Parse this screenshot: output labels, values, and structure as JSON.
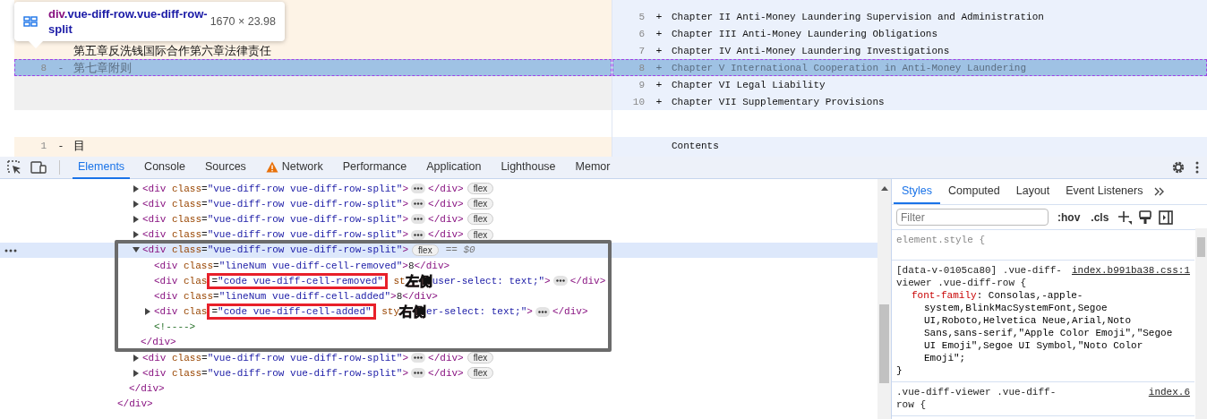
{
  "diff": {
    "left_rows": [
      {
        "kind": "cut"
      },
      {
        "kind": "hidden"
      },
      {
        "kind": "hidden"
      },
      {
        "kind": "line",
        "text": "第五章反洗钱国际合作第六章法律责任",
        "selected": false
      },
      {
        "kind": "line",
        "line": "8",
        "sign": "-",
        "text": "第七章附则",
        "selected": true
      },
      {
        "kind": "empty"
      },
      {
        "kind": "empty"
      }
    ],
    "right_rows": [
      {
        "kind": "cut"
      },
      {
        "kind": "line",
        "line": "5",
        "sign": "+",
        "text": "Chapter II Anti-Money Laundering Supervision and Administration",
        "selected": false
      },
      {
        "kind": "line",
        "line": "6",
        "sign": "+",
        "text": "Chapter III Anti-Money Laundering Obligations",
        "selected": false
      },
      {
        "kind": "line",
        "line": "7",
        "sign": "+",
        "text": "Chapter IV Anti-Money Laundering Investigations",
        "selected": false
      },
      {
        "kind": "line",
        "line": "8",
        "sign": "+",
        "text": "Chapter V International Cooperation in Anti-Money Laundering",
        "selected": true
      },
      {
        "kind": "line",
        "line": "9",
        "sign": "+",
        "text": "Chapter VI Legal Liability",
        "selected": false
      },
      {
        "kind": "line",
        "line": "10",
        "sign": "+",
        "text": "Chapter VII Supplementary Provisions",
        "selected": false
      }
    ],
    "next_left": {
      "line": "1",
      "sign": "-",
      "text": "目"
    },
    "next_right": {
      "text": "Contents"
    },
    "tooltip": {
      "tag": "div",
      "classes": ".vue-diff-row.vue-diff-row-split",
      "size": "1670 × 23.98"
    }
  },
  "devtools": {
    "tabs": [
      {
        "label": "Elements",
        "selected": true,
        "warning": false
      },
      {
        "label": "Console",
        "selected": false,
        "warning": false
      },
      {
        "label": "Sources",
        "selected": false,
        "warning": false
      },
      {
        "label": "Network",
        "selected": false,
        "warning": true
      },
      {
        "label": "Performance",
        "selected": false,
        "warning": false
      },
      {
        "label": "Application",
        "selected": false,
        "warning": false
      },
      {
        "label": "Lighthouse",
        "selected": false,
        "warning": false
      },
      {
        "label": "Memor",
        "selected": false,
        "warning": false
      }
    ],
    "dom_tree": [
      {
        "children": [
          {
            "close": [
              {
                "kind": "code",
                "tokens": [
                  {
                    "tag": "</div>"
                  }
                ]
              }
            ],
            "children": [
              {
                "close": [
                  {
                    "kind": "code",
                    "tokens": [
                      {
                        "tag": "</div>"
                      }
                    ]
                  }
                ],
                "children": [
                  {
                    "expanded": false,
                    "selected": false,
                    "parts": [
                      {
                        "kind": "code",
                        "tokens": [
                          {
                            "tag": "<div"
                          },
                          {
                            "attr": " class"
                          },
                          {
                            "plain": "="
                          },
                          {
                            "value": "\"vue-diff-row vue-diff-row-split\""
                          },
                          {
                            "tag": ">"
                          }
                        ]
                      },
                      {
                        "kind": "ellipsis"
                      },
                      {
                        "kind": "code",
                        "tokens": [
                          {
                            "tag": "</div>"
                          }
                        ]
                      },
                      {
                        "kind": "badge",
                        "text": "flex"
                      }
                    ]
                  },
                  {
                    "expanded": false,
                    "selected": false,
                    "parts": [
                      {
                        "kind": "code",
                        "tokens": [
                          {
                            "tag": "<div"
                          },
                          {
                            "attr": " class"
                          },
                          {
                            "plain": "="
                          },
                          {
                            "value": "\"vue-diff-row vue-diff-row-split\""
                          },
                          {
                            "tag": ">"
                          }
                        ]
                      },
                      {
                        "kind": "ellipsis"
                      },
                      {
                        "kind": "code",
                        "tokens": [
                          {
                            "tag": "</div>"
                          }
                        ]
                      },
                      {
                        "kind": "badge",
                        "text": "flex"
                      }
                    ]
                  },
                  {
                    "expanded": false,
                    "selected": false,
                    "parts": [
                      {
                        "kind": "code",
                        "tokens": [
                          {
                            "tag": "<div"
                          },
                          {
                            "attr": " class"
                          },
                          {
                            "plain": "="
                          },
                          {
                            "value": "\"vue-diff-row vue-diff-row-split\""
                          },
                          {
                            "tag": ">"
                          }
                        ]
                      },
                      {
                        "kind": "ellipsis"
                      },
                      {
                        "kind": "code",
                        "tokens": [
                          {
                            "tag": "</div>"
                          }
                        ]
                      },
                      {
                        "kind": "badge",
                        "text": "flex"
                      }
                    ]
                  },
                  {
                    "expanded": false,
                    "selected": false,
                    "parts": [
                      {
                        "kind": "code",
                        "tokens": [
                          {
                            "tag": "<div"
                          },
                          {
                            "attr": " class"
                          },
                          {
                            "plain": "="
                          },
                          {
                            "value": "\"vue-diff-row vue-diff-row-split\""
                          },
                          {
                            "tag": ">"
                          }
                        ]
                      },
                      {
                        "kind": "ellipsis"
                      },
                      {
                        "kind": "code",
                        "tokens": [
                          {
                            "tag": "</div>"
                          }
                        ]
                      },
                      {
                        "kind": "badge",
                        "text": "flex"
                      }
                    ]
                  },
                  {
                    "expanded": true,
                    "selected": true,
                    "parts": [
                      {
                        "kind": "code",
                        "tokens": [
                          {
                            "tag": "<div"
                          },
                          {
                            "attr": " class"
                          },
                          {
                            "plain": "="
                          },
                          {
                            "value": "\"vue-diff-row vue-diff-row-split\""
                          },
                          {
                            "tag": ">"
                          }
                        ]
                      },
                      {
                        "kind": "badge",
                        "text": "flex"
                      },
                      {
                        "kind": "marker",
                        "text": "== $0"
                      }
                    ],
                    "close": [
                      {
                        "kind": "code",
                        "tokens": [
                          {
                            "tag": "</div>"
                          }
                        ]
                      }
                    ],
                    "children": [
                      {
                        "parts": [
                          {
                            "kind": "code",
                            "tokens": [
                              {
                                "tag": "<div"
                              },
                              {
                                "attr": " class"
                              },
                              {
                                "plain": "="
                              },
                              {
                                "value": "\"lineNum vue-diff-cell-removed\""
                              },
                              {
                                "tag": ">"
                              },
                              {
                                "plain": "8"
                              },
                              {
                                "tag": "</div>"
                              }
                            ]
                          }
                        ]
                      },
                      {
                        "parts": [
                          {
                            "kind": "code",
                            "tokens": [
                              {
                                "tag": "<div"
                              },
                              {
                                "attr": " clas"
                              }
                            ]
                          },
                          {
                            "kind": "boxed",
                            "tokens": [
                              {
                                "plain": "="
                              },
                              {
                                "value": "\"code vue-diff-cell-removed\""
                              }
                            ]
                          },
                          {
                            "kind": "code",
                            "tokens": [
                              {
                                "attr": " st"
                              }
                            ]
                          },
                          {
                            "kind": "note",
                            "text": "左侧"
                          },
                          {
                            "kind": "code",
                            "tokens": [
                              {
                                "value": "user-select: text;\""
                              },
                              {
                                "tag": ">"
                              }
                            ]
                          },
                          {
                            "kind": "ellipsis"
                          },
                          {
                            "kind": "code",
                            "tokens": [
                              {
                                "tag": "</div>"
                              }
                            ]
                          }
                        ]
                      },
                      {
                        "parts": [
                          {
                            "kind": "code",
                            "tokens": [
                              {
                                "tag": "<div"
                              },
                              {
                                "attr": " class"
                              },
                              {
                                "plain": "="
                              },
                              {
                                "value": "\"lineNum vue-diff-cell-added\""
                              },
                              {
                                "tag": ">"
                              },
                              {
                                "plain": "8"
                              },
                              {
                                "tag": "</div>"
                              }
                            ]
                          }
                        ]
                      },
                      {
                        "expanded": false,
                        "parts": [
                          {
                            "kind": "code",
                            "tokens": [
                              {
                                "tag": "<div"
                              },
                              {
                                "attr": " clas"
                              }
                            ]
                          },
                          {
                            "kind": "boxed",
                            "tokens": [
                              {
                                "plain": "="
                              },
                              {
                                "value": "\"code vue-diff-cell-added\""
                              }
                            ]
                          },
                          {
                            "kind": "code",
                            "tokens": [
                              {
                                "attr": " sty"
                              }
                            ]
                          },
                          {
                            "kind": "note",
                            "text": "右侧"
                          },
                          {
                            "kind": "code",
                            "tokens": [
                              {
                                "value": "er-select: text;\""
                              },
                              {
                                "tag": ">"
                              }
                            ]
                          },
                          {
                            "kind": "ellipsis"
                          },
                          {
                            "kind": "code",
                            "tokens": [
                              {
                                "tag": "</div>"
                              }
                            ]
                          }
                        ]
                      },
                      {
                        "parts": [
                          {
                            "kind": "code",
                            "tokens": [
                              {
                                "comment": "<!---->"
                              }
                            ]
                          }
                        ]
                      }
                    ]
                  },
                  {
                    "expanded": false,
                    "selected": false,
                    "parts": [
                      {
                        "kind": "code",
                        "tokens": [
                          {
                            "tag": "<div"
                          },
                          {
                            "attr": " class"
                          },
                          {
                            "plain": "="
                          },
                          {
                            "value": "\"vue-diff-row vue-diff-row-split\""
                          },
                          {
                            "tag": ">"
                          }
                        ]
                      },
                      {
                        "kind": "ellipsis"
                      },
                      {
                        "kind": "code",
                        "tokens": [
                          {
                            "tag": "</div>"
                          }
                        ]
                      },
                      {
                        "kind": "badge",
                        "text": "flex"
                      }
                    ]
                  },
                  {
                    "expanded": false,
                    "selected": false,
                    "parts": [
                      {
                        "kind": "code",
                        "tokens": [
                          {
                            "tag": "<div"
                          },
                          {
                            "attr": " class"
                          },
                          {
                            "plain": "="
                          },
                          {
                            "value": "\"vue-diff-row vue-diff-row-split\""
                          },
                          {
                            "tag": ">"
                          }
                        ]
                      },
                      {
                        "kind": "ellipsis"
                      },
                      {
                        "kind": "code",
                        "tokens": [
                          {
                            "tag": "</div>"
                          }
                        ]
                      },
                      {
                        "kind": "badge",
                        "text": "flex"
                      }
                    ]
                  }
                ]
              }
            ]
          }
        ]
      }
    ],
    "styles": {
      "tabs": [
        {
          "label": "Styles",
          "selected": true
        },
        {
          "label": "Computed",
          "selected": false
        },
        {
          "label": "Layout",
          "selected": false
        },
        {
          "label": "Event Listeners",
          "selected": false
        }
      ],
      "filter_placeholder": "Filter",
      "hov": ":hov",
      "cls": ".cls",
      "rules": [
        {
          "selector": "element.style {",
          "muted": true
        },
        {
          "selector": "[data-v-0105ca80] .vue-diff-viewer .vue-diff-row {",
          "source": "index.b991ba38.css:1",
          "declarations": [
            {
              "prop": "font-family",
              "sep": ":",
              "value": "Consolas,-apple-system,BlinkMacSystemFont,Segoe UI,Roboto,Helvetica Neue,Arial,Noto Sans,sans-serif,\"Apple Color Emoji\",\"Segoe UI Emoji\",Segoe UI Symbol,\"Noto Color Emoji\";"
            }
          ],
          "close": "}",
          "muted": false
        },
        {
          "selector": ".vue-diff-viewer .vue-diff-row {",
          "source": "index.6",
          "muted": false
        }
      ]
    }
  }
}
